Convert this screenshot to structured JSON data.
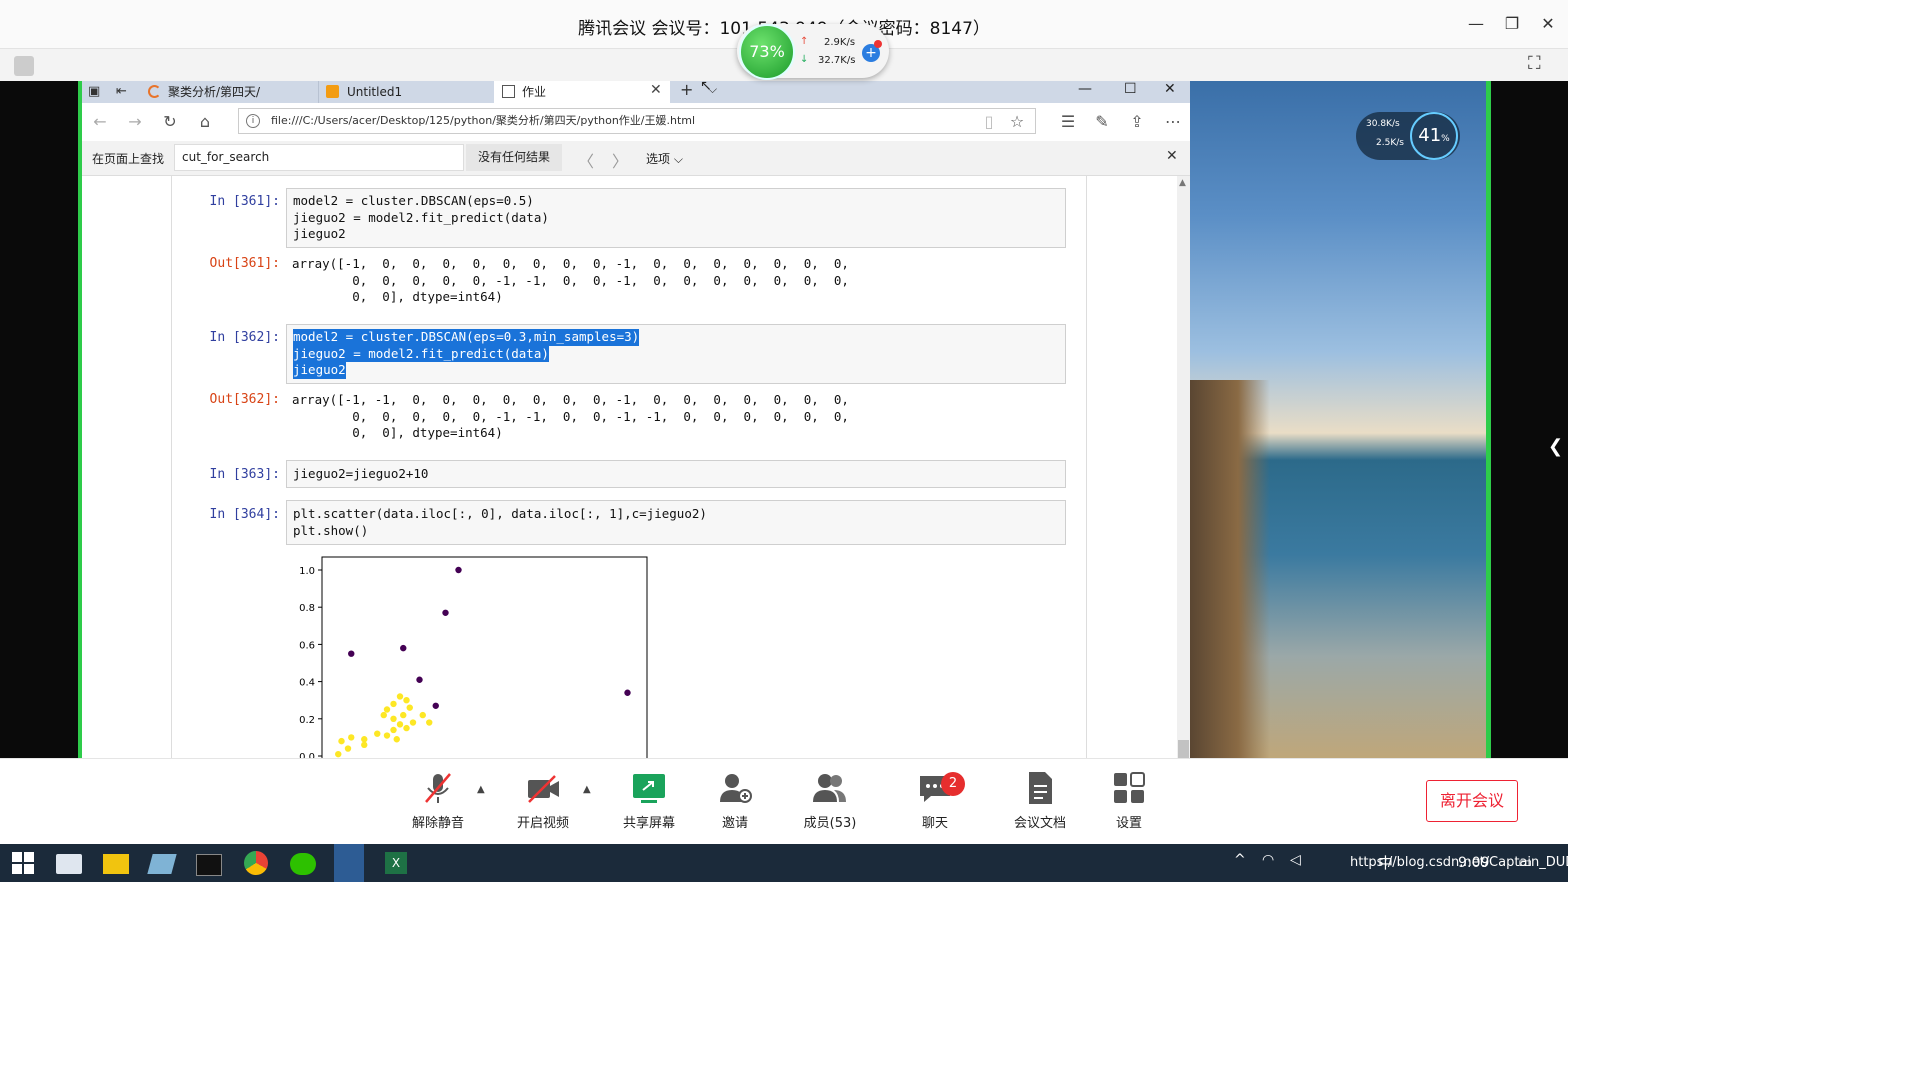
{
  "meeting": {
    "title": "腾讯会议 会议号：101 543 949（会议密码：8147）",
    "window_controls": [
      "—",
      "❐",
      "✕"
    ]
  },
  "network": {
    "percent": "73%",
    "upload": "2.9K/s",
    "download": "32.7K/s"
  },
  "browser": {
    "tabs": [
      {
        "label": "聚类分析/第四天/"
      },
      {
        "label": "Untitled1"
      },
      {
        "label": "作业"
      }
    ],
    "url": "file:///C:/Users/acer/Desktop/125/python/聚类分析/第四天/python作业/王媛.html",
    "find": {
      "label": "在页面上查找",
      "value": "cut_for_search",
      "result": "没有任何结果",
      "options_label": "选项"
    }
  },
  "notebook": {
    "cells": [
      {
        "prompt": "In [361]:",
        "lines": [
          "model2 = cluster.DBSCAN(eps=0.5)",
          "jieguo2 = model2.fit_predict(data)",
          "jieguo2"
        ]
      },
      {
        "prompt": "Out[361]:",
        "lines": [
          "array([-1,  0,  0,  0,  0,  0,  0,  0,  0, -1,  0,  0,  0,  0,  0,  0,  0,",
          "        0,  0,  0,  0,  0, -1, -1,  0,  0, -1,  0,  0,  0,  0,  0,  0,  0,",
          "        0,  0], dtype=int64)"
        ]
      },
      {
        "prompt": "In [362]:",
        "lines": [
          "model2 = cluster.DBSCAN(eps=0.3,min_samples=3)",
          "jieguo2 = model2.fit_predict(data)",
          "jieguo2"
        ]
      },
      {
        "prompt": "Out[362]:",
        "lines": [
          "array([-1, -1,  0,  0,  0,  0,  0,  0,  0, -1,  0,  0,  0,  0,  0,  0,  0,",
          "        0,  0,  0,  0,  0, -1, -1,  0,  0, -1, -1,  0,  0,  0,  0,  0,  0,",
          "        0,  0], dtype=int64)"
        ]
      },
      {
        "prompt": "In [363]:",
        "lines": [
          "jieguo2=jieguo2+10"
        ]
      },
      {
        "prompt": "In [364]:",
        "lines": [
          "plt.scatter(data.iloc[:, 0], data.iloc[:, 1],c=jieguo2)",
          "plt.show()"
        ]
      }
    ]
  },
  "chart_data": {
    "type": "scatter",
    "ylim": [
      0.0,
      1.05
    ],
    "xlim": [
      0.0,
      1.0
    ],
    "yticks": [
      "1.0",
      "0.8",
      "0.6",
      "0.4",
      "0.2",
      "0.0"
    ],
    "ytick_values": [
      1.0,
      0.8,
      0.6,
      0.4,
      0.2,
      0.0
    ],
    "colors": {
      "noise": "#440154",
      "cluster": "#fde725"
    },
    "series": [
      {
        "points": [
          [
            0.42,
            1.0
          ],
          [
            0.38,
            0.77
          ],
          [
            0.09,
            0.55
          ],
          [
            0.25,
            0.58
          ],
          [
            0.3,
            0.41
          ],
          [
            0.35,
            0.27
          ],
          [
            0.94,
            0.34
          ]
        ],
        "class": "noise"
      },
      {
        "points": [
          [
            0.05,
            0.01
          ],
          [
            0.08,
            0.04
          ],
          [
            0.06,
            0.08
          ],
          [
            0.09,
            0.1
          ],
          [
            0.13,
            0.09
          ],
          [
            0.13,
            0.06
          ],
          [
            0.17,
            0.12
          ],
          [
            0.2,
            0.11
          ],
          [
            0.23,
            0.09
          ],
          [
            0.22,
            0.14
          ],
          [
            0.2,
            0.25
          ],
          [
            0.22,
            0.28
          ],
          [
            0.24,
            0.32
          ],
          [
            0.26,
            0.3
          ],
          [
            0.22,
            0.2
          ],
          [
            0.25,
            0.22
          ],
          [
            0.24,
            0.17
          ],
          [
            0.27,
            0.26
          ],
          [
            0.28,
            0.18
          ],
          [
            0.31,
            0.22
          ],
          [
            0.26,
            0.15
          ],
          [
            0.33,
            0.18
          ],
          [
            0.19,
            0.22
          ]
        ],
        "class": "cluster"
      }
    ]
  },
  "toolbar": {
    "items": [
      {
        "label": "解除静音",
        "icon": "mic-muted-icon"
      },
      {
        "label": "开启视频",
        "icon": "camera-off-icon"
      },
      {
        "label": "共享屏幕",
        "icon": "share-screen-icon"
      },
      {
        "label": "邀请",
        "icon": "invite-icon"
      },
      {
        "label": "成员(53)",
        "icon": "members-icon"
      },
      {
        "label": "聊天",
        "icon": "chat-icon"
      },
      {
        "label": "会议文档",
        "icon": "document-icon"
      },
      {
        "label": "设置",
        "icon": "settings-icon"
      }
    ],
    "chat_badge": "2",
    "leave_label": "离开会议"
  },
  "monitor": {
    "up": "30.8K/s",
    "down": "2.5K/s",
    "percent": "41",
    "percent_unit": "%"
  },
  "taskbar": {
    "tray": "https://blog.csdn.net/Captain_DUDU",
    "ime": "中",
    "time": "9:09"
  }
}
